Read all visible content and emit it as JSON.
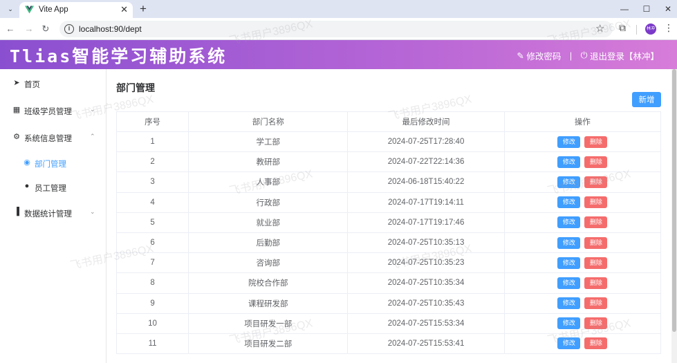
{
  "browser": {
    "tab_title": "Vite App",
    "new_tab": "+",
    "url": "localhost:90/dept",
    "window_controls": [
      "minimize-icon",
      "maximize-icon",
      "close-icon"
    ],
    "profile_initials": "林冲"
  },
  "header": {
    "title": "Tlias智能学习辅助系统",
    "change_password": "修改密码",
    "separator": "|",
    "logout": "退出登录【林冲】",
    "gradient_colors": [
      "#8a4fd0",
      "#d77cd9"
    ]
  },
  "sidebar": {
    "items": [
      {
        "label": "首页",
        "icon": "send-icon"
      },
      {
        "label": "班级学员管理",
        "icon": "grid-icon"
      },
      {
        "label": "系统信息管理",
        "icon": "gear-icon"
      },
      {
        "label": "部门管理",
        "icon": "compass-icon"
      },
      {
        "label": "员工管理",
        "icon": "user-icon"
      },
      {
        "label": "数据统计管理",
        "icon": "bar-chart-icon"
      }
    ]
  },
  "main": {
    "title": "部门管理",
    "add_label": "新增",
    "table": {
      "headers": [
        "序号",
        "部门名称",
        "最后修改时间",
        "操作"
      ],
      "edit_label": "修改",
      "delete_label": "删除",
      "rows": [
        {
          "no": "1",
          "name": "学工部",
          "time": "2024-07-25T17:28:40"
        },
        {
          "no": "2",
          "name": "教研部",
          "time": "2024-07-22T22:14:36"
        },
        {
          "no": "3",
          "name": "人事部",
          "time": "2024-06-18T15:40:22"
        },
        {
          "no": "4",
          "name": "行政部",
          "time": "2024-07-17T19:14:11"
        },
        {
          "no": "5",
          "name": "就业部",
          "time": "2024-07-17T19:17:46"
        },
        {
          "no": "6",
          "name": "后勤部",
          "time": "2024-07-25T10:35:13"
        },
        {
          "no": "7",
          "name": "咨询部",
          "time": "2024-07-25T10:35:23"
        },
        {
          "no": "8",
          "name": "院校合作部",
          "time": "2024-07-25T10:35:34"
        },
        {
          "no": "9",
          "name": "课程研发部",
          "time": "2024-07-25T10:35:43"
        },
        {
          "no": "10",
          "name": "项目研发一部",
          "time": "2024-07-25T15:53:34"
        },
        {
          "no": "11",
          "name": "项目研发二部",
          "time": "2024-07-25T15:53:41"
        }
      ]
    }
  },
  "watermark": "飞书用户3896QX",
  "colors": {
    "primary": "#409eff",
    "danger": "#f56c6c",
    "accent": "#8a4fd0"
  }
}
